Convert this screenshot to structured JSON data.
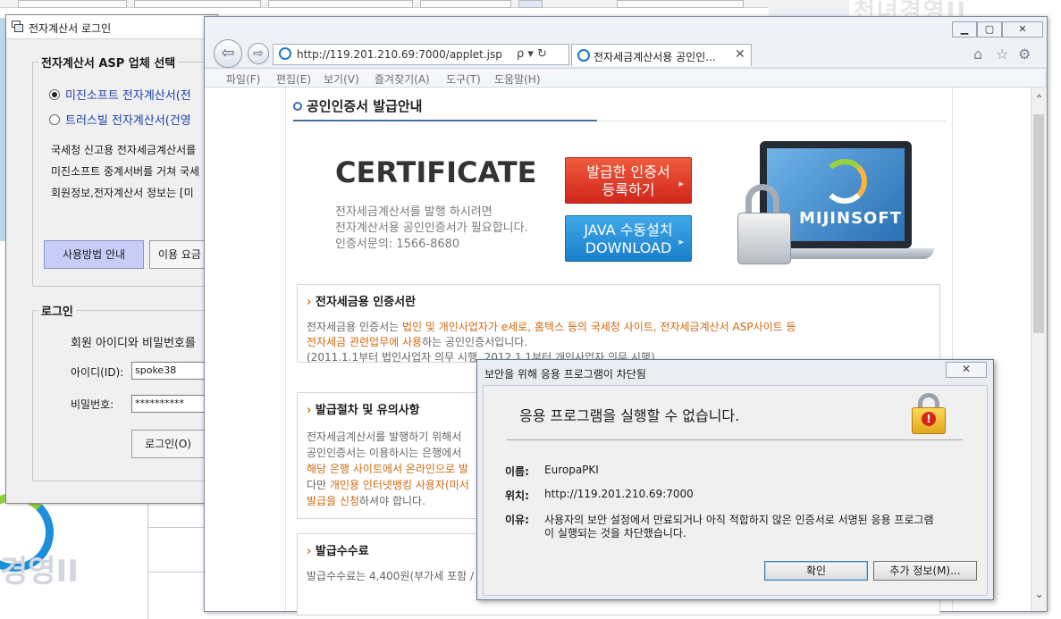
{
  "background": {
    "logo_text_top": "천녀경영II",
    "logo_text_bottom": "경영II"
  },
  "login_window": {
    "title": "전자계산서 로그인",
    "asp_group_title": "전자계산서 ASP 업체 선택",
    "options": [
      {
        "label": "미진소프트 전자계산서(전",
        "selected": true
      },
      {
        "label": "트러스빌 전자계산서(건영",
        "selected": false
      }
    ],
    "info_lines": [
      "국세청 신고용 전자세금계산서를",
      "미진소프트 중계서버를 거쳐 국세",
      "회원정보,전자계산서 정보는 [미"
    ],
    "usage_button": "사용방법 안내",
    "fee_button": "이용 요금",
    "login_group_title": "로그인",
    "login_prompt": "회원 아이디와 비밀번호를",
    "id_label": "아이디(ID):",
    "id_value": "spoke38",
    "pw_label": "비밀번호:",
    "pw_value": "**********",
    "login_button": "로그인(O)"
  },
  "browser": {
    "address": "http://119.201.210.69:7000/applet.jsp",
    "address_suffix": "ρ ▾ ↻",
    "tab_title": "전자세금계산서용 공인인...",
    "menu": [
      "파일(F)",
      "편집(E)",
      "보기(V)",
      "즐겨찾기(A)",
      "도구(T)",
      "도움말(H)"
    ],
    "page": {
      "heading": "공인인증서 발급안내",
      "cert_title": "CERTIFICATE",
      "cert_desc": [
        "전자세금계산서를 발행 하시려면",
        "전자계산서용 공인인증서가 필요합니다.",
        "인증서문의:  1566-8680"
      ],
      "btn_register": [
        "발급한 인증서",
        "등록하기"
      ],
      "btn_java": [
        "JAVA 수동설치",
        "DOWNLOAD"
      ],
      "laptop_logo": "MIJINSOFT",
      "section1": {
        "title": "전자세금용 인증서란",
        "line1_a": "전자세금용 인증서는 ",
        "line1_b": "법인 및 개인사업자가 e세로, 홈텍스 등의 국세청 사이트, 전자세금계산서 ASP사이트 등",
        "line2_a": "전자세금 관련업무에 사용",
        "line2_b": "하는 공인인증서입니다.",
        "line3": "(2011.1.1부터 법인사업자 의무 시행, 2012.1.1부터 개인사업자 의무 시행)"
      },
      "section2": {
        "title": "발급절차 및 유의사항",
        "line1": "전자세금계산서를 발행하기 위해서",
        "line2": "공인인증서는 이용하시는 은행에서",
        "line3": "해당 은행 사이트에서 온라인으로 발",
        "line4_a": "다만 ",
        "line4_b": "개인용 인터넷뱅킹 사용자(미서",
        "line5_a": "발급을 신청",
        "line5_b": "하셔야 합니다."
      },
      "section3": {
        "title": "발급수수료",
        "line1": "발급수수료는 4,400원(부가세 포함 /"
      }
    }
  },
  "dialog": {
    "title": "보안을 위해 응용 프로그램이 차단됨",
    "headline": "응용 프로그램을 실행할 수 없습니다.",
    "name_label": "이름:",
    "name_value": "EuropaPKI",
    "location_label": "위치:",
    "location_value": "http://119.201.210.69:7000",
    "reason_label": "이유:",
    "reason_line1": "사용자의 보안 설정에서 만료되거나 아직 적합하지 않은 인증서로 서명된 응용 프로그램",
    "reason_line2": "이 실행되는 것을 차단했습니다.",
    "ok_button": "확인",
    "more_button": "추가 정보(M)..."
  }
}
